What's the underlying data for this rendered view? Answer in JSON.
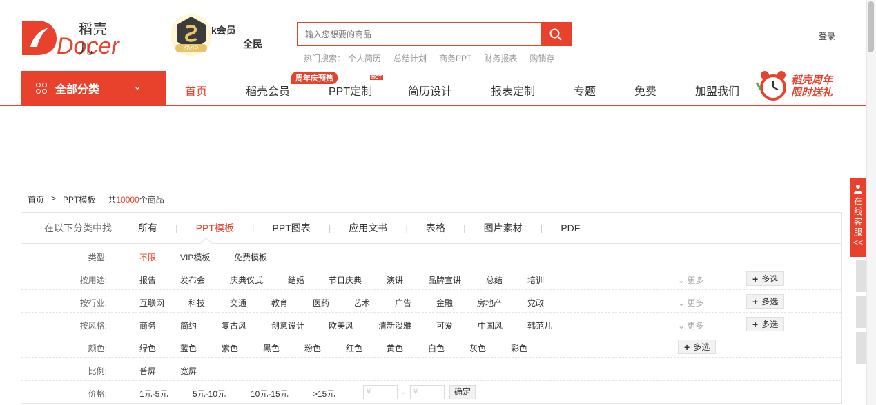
{
  "header": {
    "logo_cn": "稻壳儿",
    "logo_text": "Docer",
    "svip_badge": "SVIP",
    "vip_text": "k会员",
    "vip_text2": "全民",
    "search_placeholder": "输入您想要的商品",
    "hot_label": "热门搜索：",
    "hot_items": [
      "个人简历",
      "总结计划",
      "商务PPT",
      "财务报表",
      "购销存"
    ],
    "login": "登录"
  },
  "nav": {
    "all_categories": "全部分类",
    "items": [
      "首页",
      "稻壳会员",
      "PPT定制",
      "简历设计",
      "报表定制",
      "专题",
      "免费",
      "加盟我们"
    ],
    "badge": "周年庆预热",
    "hot_badge": "HOT",
    "promo_line1": "稻壳周年",
    "promo_line2": "限时送礼"
  },
  "breadcrumb": {
    "home": "首页",
    "sep": ">",
    "current": "PPT模板",
    "count_prefix": "共",
    "count": "10000",
    "count_suffix": "个商品"
  },
  "filter": {
    "tabs_label": "在以下分类中找",
    "tabs": [
      "所有",
      "PPT模板",
      "PPT图表",
      "应用文书",
      "表格",
      "图片素材",
      "PDF"
    ],
    "rows": [
      {
        "key": "类型:",
        "options": [
          "不限",
          "VIP模板",
          "免费模板"
        ]
      },
      {
        "key": "按用途:",
        "options": [
          "报告",
          "发布会",
          "庆典仪式",
          "结婚",
          "节日庆典",
          "演讲",
          "品牌宣讲",
          "总结",
          "培训"
        ]
      },
      {
        "key": "按行业:",
        "options": [
          "互联网",
          "科技",
          "交通",
          "教育",
          "医药",
          "艺术",
          "广告",
          "金融",
          "房地产",
          "党政"
        ]
      },
      {
        "key": "按风格:",
        "options": [
          "商务",
          "简约",
          "复古风",
          "创意设计",
          "欧美风",
          "清新淡雅",
          "可爱",
          "中国风",
          "韩范儿"
        ]
      },
      {
        "key": "颜色:",
        "options": [
          "绿色",
          "蓝色",
          "紫色",
          "黑色",
          "粉色",
          "红色",
          "黄色",
          "白色",
          "灰色",
          "彩色"
        ]
      },
      {
        "key": "比例:",
        "options": [
          "普屏",
          "宽屏"
        ]
      },
      {
        "key": "价格:",
        "options": [
          "1元-5元",
          "5元-10元",
          "10元-15元",
          ">15元"
        ]
      }
    ],
    "more": "更多",
    "multi": "多选",
    "price_ph": "¥",
    "price_dash": "-",
    "confirm": "确定"
  },
  "side": {
    "online_service": "在线客服",
    "collapse": "<<"
  },
  "colors": {
    "brand": "#e8412c"
  }
}
